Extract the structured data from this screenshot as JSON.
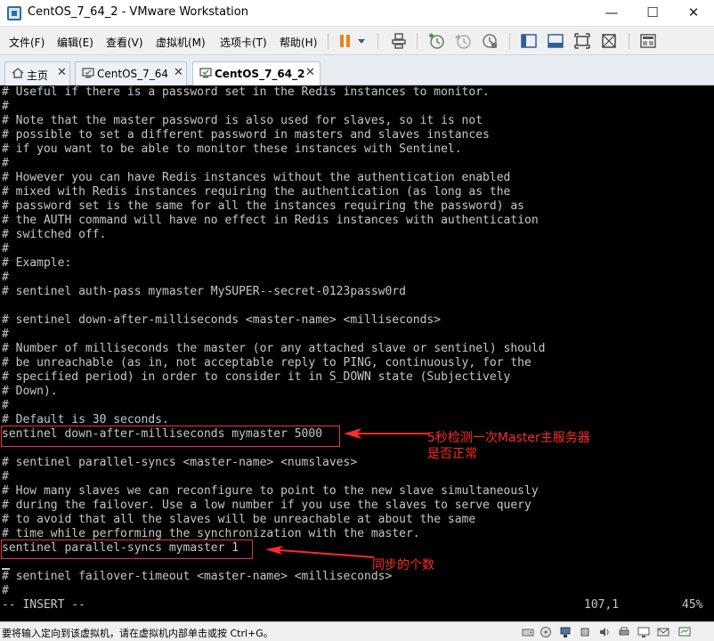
{
  "window": {
    "title": "CentOS_7_64_2 - VMware Workstation",
    "controls": {
      "minimize": "—",
      "maximize": "☐",
      "close": "✕"
    }
  },
  "menu": {
    "items": [
      "文件(F)",
      "编辑(E)",
      "查看(V)",
      "虚拟机(M)",
      "选项卡(T)",
      "帮助(H)"
    ]
  },
  "toolbar": {
    "icons": [
      "pause-icon",
      "dropdown-arrow-icon",
      "send-ctrl-alt-del-icon",
      "snapshot-take-icon",
      "snapshot-revert-icon",
      "snapshot-manager-icon",
      "sidebar-toggle-icon",
      "console-view-icon",
      "fullscreen-icon",
      "unity-icon",
      "library-view-icon"
    ]
  },
  "tabs": [
    {
      "label": "主页",
      "icon": "home-icon",
      "close": "✕"
    },
    {
      "label": "CentOS_7_64",
      "icon": "vm-icon",
      "close": "✕"
    },
    {
      "label": "CentOS_7_64_2",
      "icon": "vm-icon",
      "close": "✕",
      "active": true
    }
  ],
  "terminal": {
    "lines": [
      "# Useful if there is a password set in the Redis instances to monitor.",
      "#",
      "# Note that the master password is also used for slaves, so it is not",
      "# possible to set a different password in masters and slaves instances",
      "# if you want to be able to monitor these instances with Sentinel.",
      "#",
      "# However you can have Redis instances without the authentication enabled",
      "# mixed with Redis instances requiring the authentication (as long as the",
      "# password set is the same for all the instances requiring the password) as",
      "# the AUTH command will have no effect in Redis instances with authentication",
      "# switched off.",
      "#",
      "# Example:",
      "#",
      "# sentinel auth-pass mymaster MySUPER--secret-0123passw0rd",
      "",
      "# sentinel down-after-milliseconds <master-name> <milliseconds>",
      "#",
      "# Number of milliseconds the master (or any attached slave or sentinel) should",
      "# be unreachable (as in, not acceptable reply to PING, continuously, for the",
      "# specified period) in order to consider it in S_DOWN state (Subjectively",
      "# Down).",
      "#",
      "# Default is 30 seconds.",
      "sentinel down-after-milliseconds mymaster 5000",
      "",
      "# sentinel parallel-syncs <master-name> <numslaves>",
      "#",
      "# How many slaves we can reconfigure to point to the new slave simultaneously",
      "# during the failover. Use a low number if you use the slaves to serve query",
      "# to avoid that all the slaves will be unreachable at about the same",
      "# time while performing the synchronization with the master.",
      "sentinel parallel-syncs mymaster 1",
      "",
      "# sentinel failover-timeout <master-name> <milliseconds>",
      "#"
    ],
    "mode": "-- INSERT --",
    "position": "107,1",
    "percent": "45%",
    "annotations": [
      "5秒检测一次Master主服务器\n是否正常",
      "同步的个数"
    ],
    "colors": {
      "annotation": "#ff2a2a",
      "text": "#c7c7c7",
      "background": "#000000"
    }
  },
  "statusbar": {
    "text": "要将输入定向到该虚拟机，请在虚拟机内部单击或按 Ctrl+G。",
    "icons": [
      "hdd-icon",
      "cdrom-icon",
      "network-icon",
      "usb-icon",
      "sound-icon",
      "printer-icon",
      "display-icon",
      "message-icon"
    ]
  }
}
